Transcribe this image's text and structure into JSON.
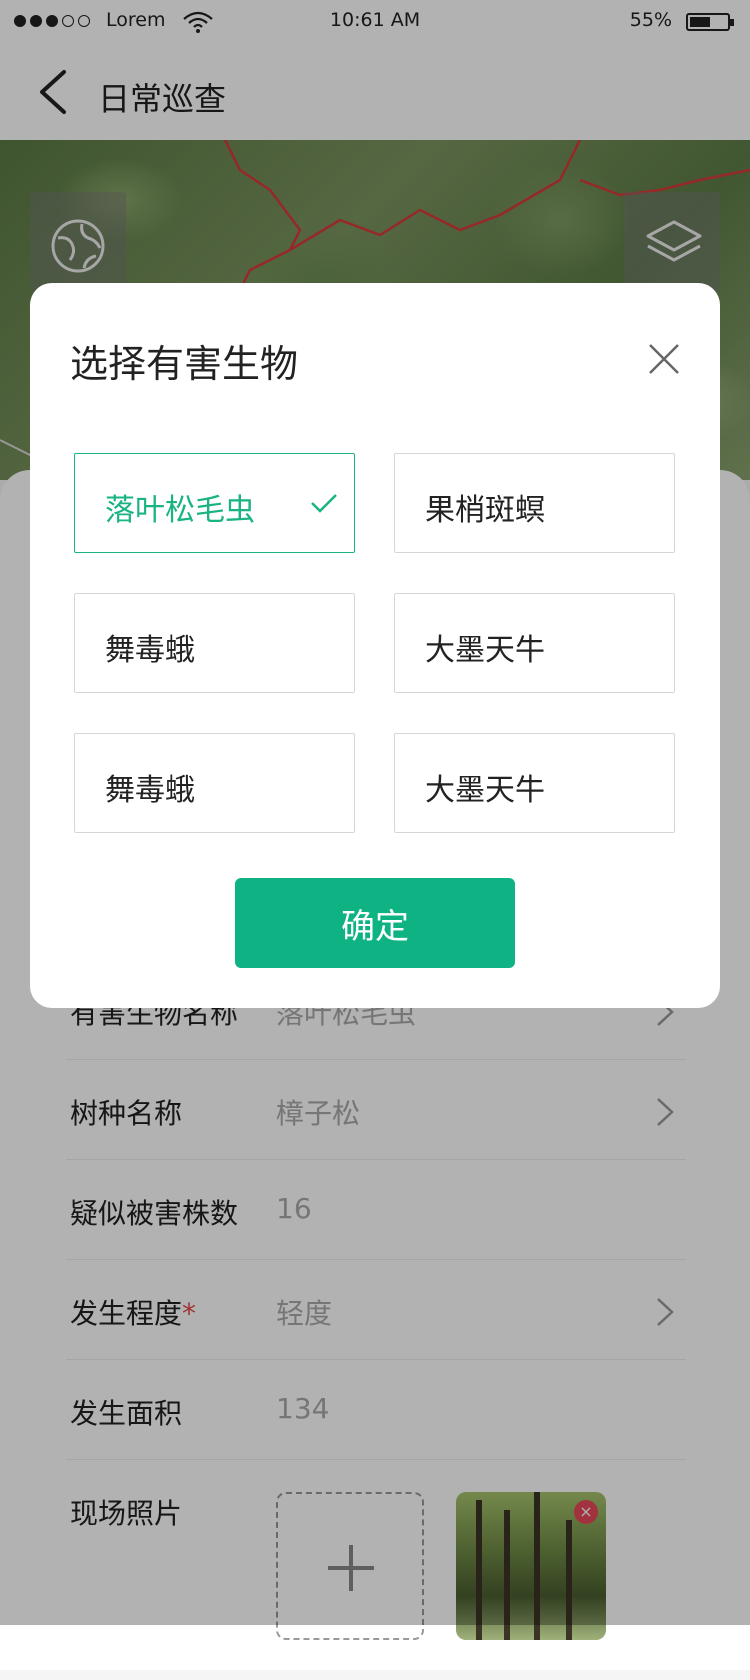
{
  "status_bar": {
    "carrier": "Lorem",
    "time": "10:61 AM",
    "battery": "55%",
    "battery_level": 0.55
  },
  "nav": {
    "title": "日常巡查"
  },
  "form": {
    "rows": [
      {
        "label": "有害生物名称",
        "value": "落叶松毛虫",
        "has_chevron": true
      },
      {
        "label": "树种名称",
        "value": "樟子松",
        "has_chevron": true
      },
      {
        "label": "疑似被害株数",
        "value": "16",
        "has_chevron": false
      },
      {
        "label": "发生程度",
        "required_mark": "*",
        "value": "轻度",
        "has_chevron": true
      },
      {
        "label": "发生面积",
        "value": "134",
        "has_chevron": false
      }
    ],
    "photo_label": "现场照片"
  },
  "modal": {
    "title": "选择有害生物",
    "options": [
      {
        "label": "落叶松毛虫",
        "selected": true
      },
      {
        "label": "果梢斑螟",
        "selected": false
      },
      {
        "label": "舞毒蛾",
        "selected": false
      },
      {
        "label": "大墨天牛",
        "selected": false
      },
      {
        "label": "舞毒蛾",
        "selected": false
      },
      {
        "label": "大墨天牛",
        "selected": false
      }
    ],
    "confirm_label": "确定"
  },
  "colors": {
    "accent": "#0fb383",
    "required": "#e64a4a"
  }
}
